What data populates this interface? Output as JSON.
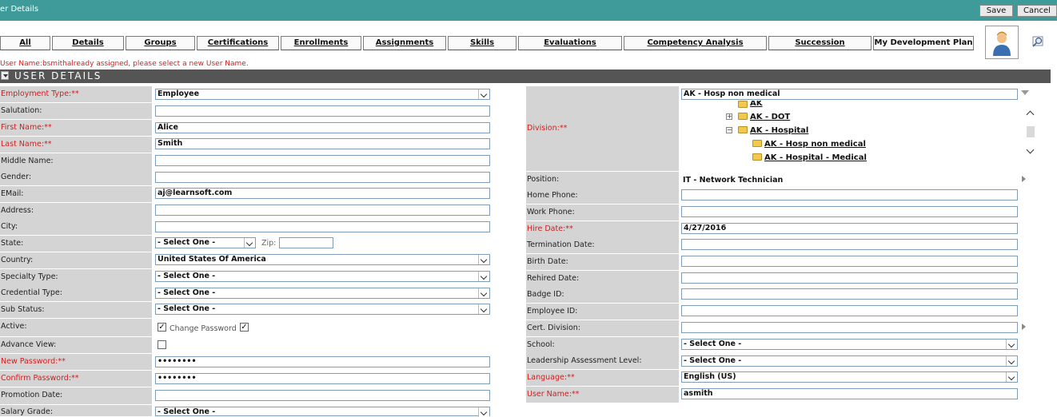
{
  "header": {
    "title": "er Details",
    "save_label": "Save",
    "cancel_label": "Cancel"
  },
  "tabs": [
    "All",
    "Details",
    "Groups",
    "Certifications",
    "Enrollments",
    "Assignments",
    "Skills",
    "Evaluations",
    "Competency Analysis",
    "Succession",
    "My Development Plan"
  ],
  "error_message": "User Name:bsmithalready assigned, please select a new User Name.",
  "section_title": "USER DETAILS",
  "left_labels": {
    "employment_type": "Employment Type:**",
    "salutation": "Salutation:",
    "first_name": "First Name:**",
    "last_name": "Last Name:**",
    "middle_name": "Middle Name:",
    "gender": "Gender:",
    "email": "EMail:",
    "address": "Address:",
    "city": "City:",
    "state": "State:",
    "country": "Country:",
    "specialty_type": "Specialty Type:",
    "credential_type": "Credential Type:",
    "sub_status": "Sub Status:",
    "active": "Active:",
    "advance_view": "Advance View:",
    "new_password": "New Password:**",
    "confirm_password": "Confirm Password:**",
    "promotion_date": "Promotion Date:",
    "salary_grade": "Salary Grade:"
  },
  "left_values": {
    "employment_type": "Employee",
    "first_name": "Alice",
    "last_name": "Smith",
    "email": "aj@learnsoft.com",
    "state": "- Select One -",
    "zip_label": "Zip:",
    "country": "United States Of America",
    "specialty_type": "- Select One -",
    "credential_type": "- Select One -",
    "sub_status": "- Select One -",
    "change_password_label": "Change Password",
    "new_password": "••••••••",
    "confirm_password": "••••••••",
    "salary_grade": "- Select One -"
  },
  "right_labels": {
    "division": "Division:**",
    "position": "Position:",
    "home_phone": "Home Phone:",
    "work_phone": "Work Phone:",
    "hire_date": "Hire Date:**",
    "termination_date": "Termination Date:",
    "birth_date": "Birth Date:",
    "rehired_date": "Rehired Date:",
    "badge_id": "Badge ID:",
    "employee_id": "Employee ID:",
    "cert_division": "Cert. Division:",
    "school": "School:",
    "leadership_level": "Leadership Assessment Level:",
    "language": "Language:**",
    "user_name": "User Name:**"
  },
  "right_values": {
    "division": "AK - Hosp non medical",
    "position": "IT - Network Technician",
    "hire_date": "4/27/2016",
    "school": "- Select One -",
    "leadership_level": "- Select One -",
    "language": "English (US)",
    "user_name": "asmith"
  },
  "division_tree": [
    "AK",
    "AK - DOT",
    "AK - Hospital",
    "AK - Hosp non medical",
    "AK - Hospital - Medical"
  ],
  "icons": [
    "user-avatar-icon",
    "search-icon",
    "folder-icon",
    "expand-icon",
    "collapse-icon",
    "checkbox-checked-icon"
  ],
  "colors": {
    "header_teal": "#3f9b9a",
    "section_bar": "#555555",
    "label_bg": "#d4d4d4",
    "required_red": "#d21e1e"
  }
}
